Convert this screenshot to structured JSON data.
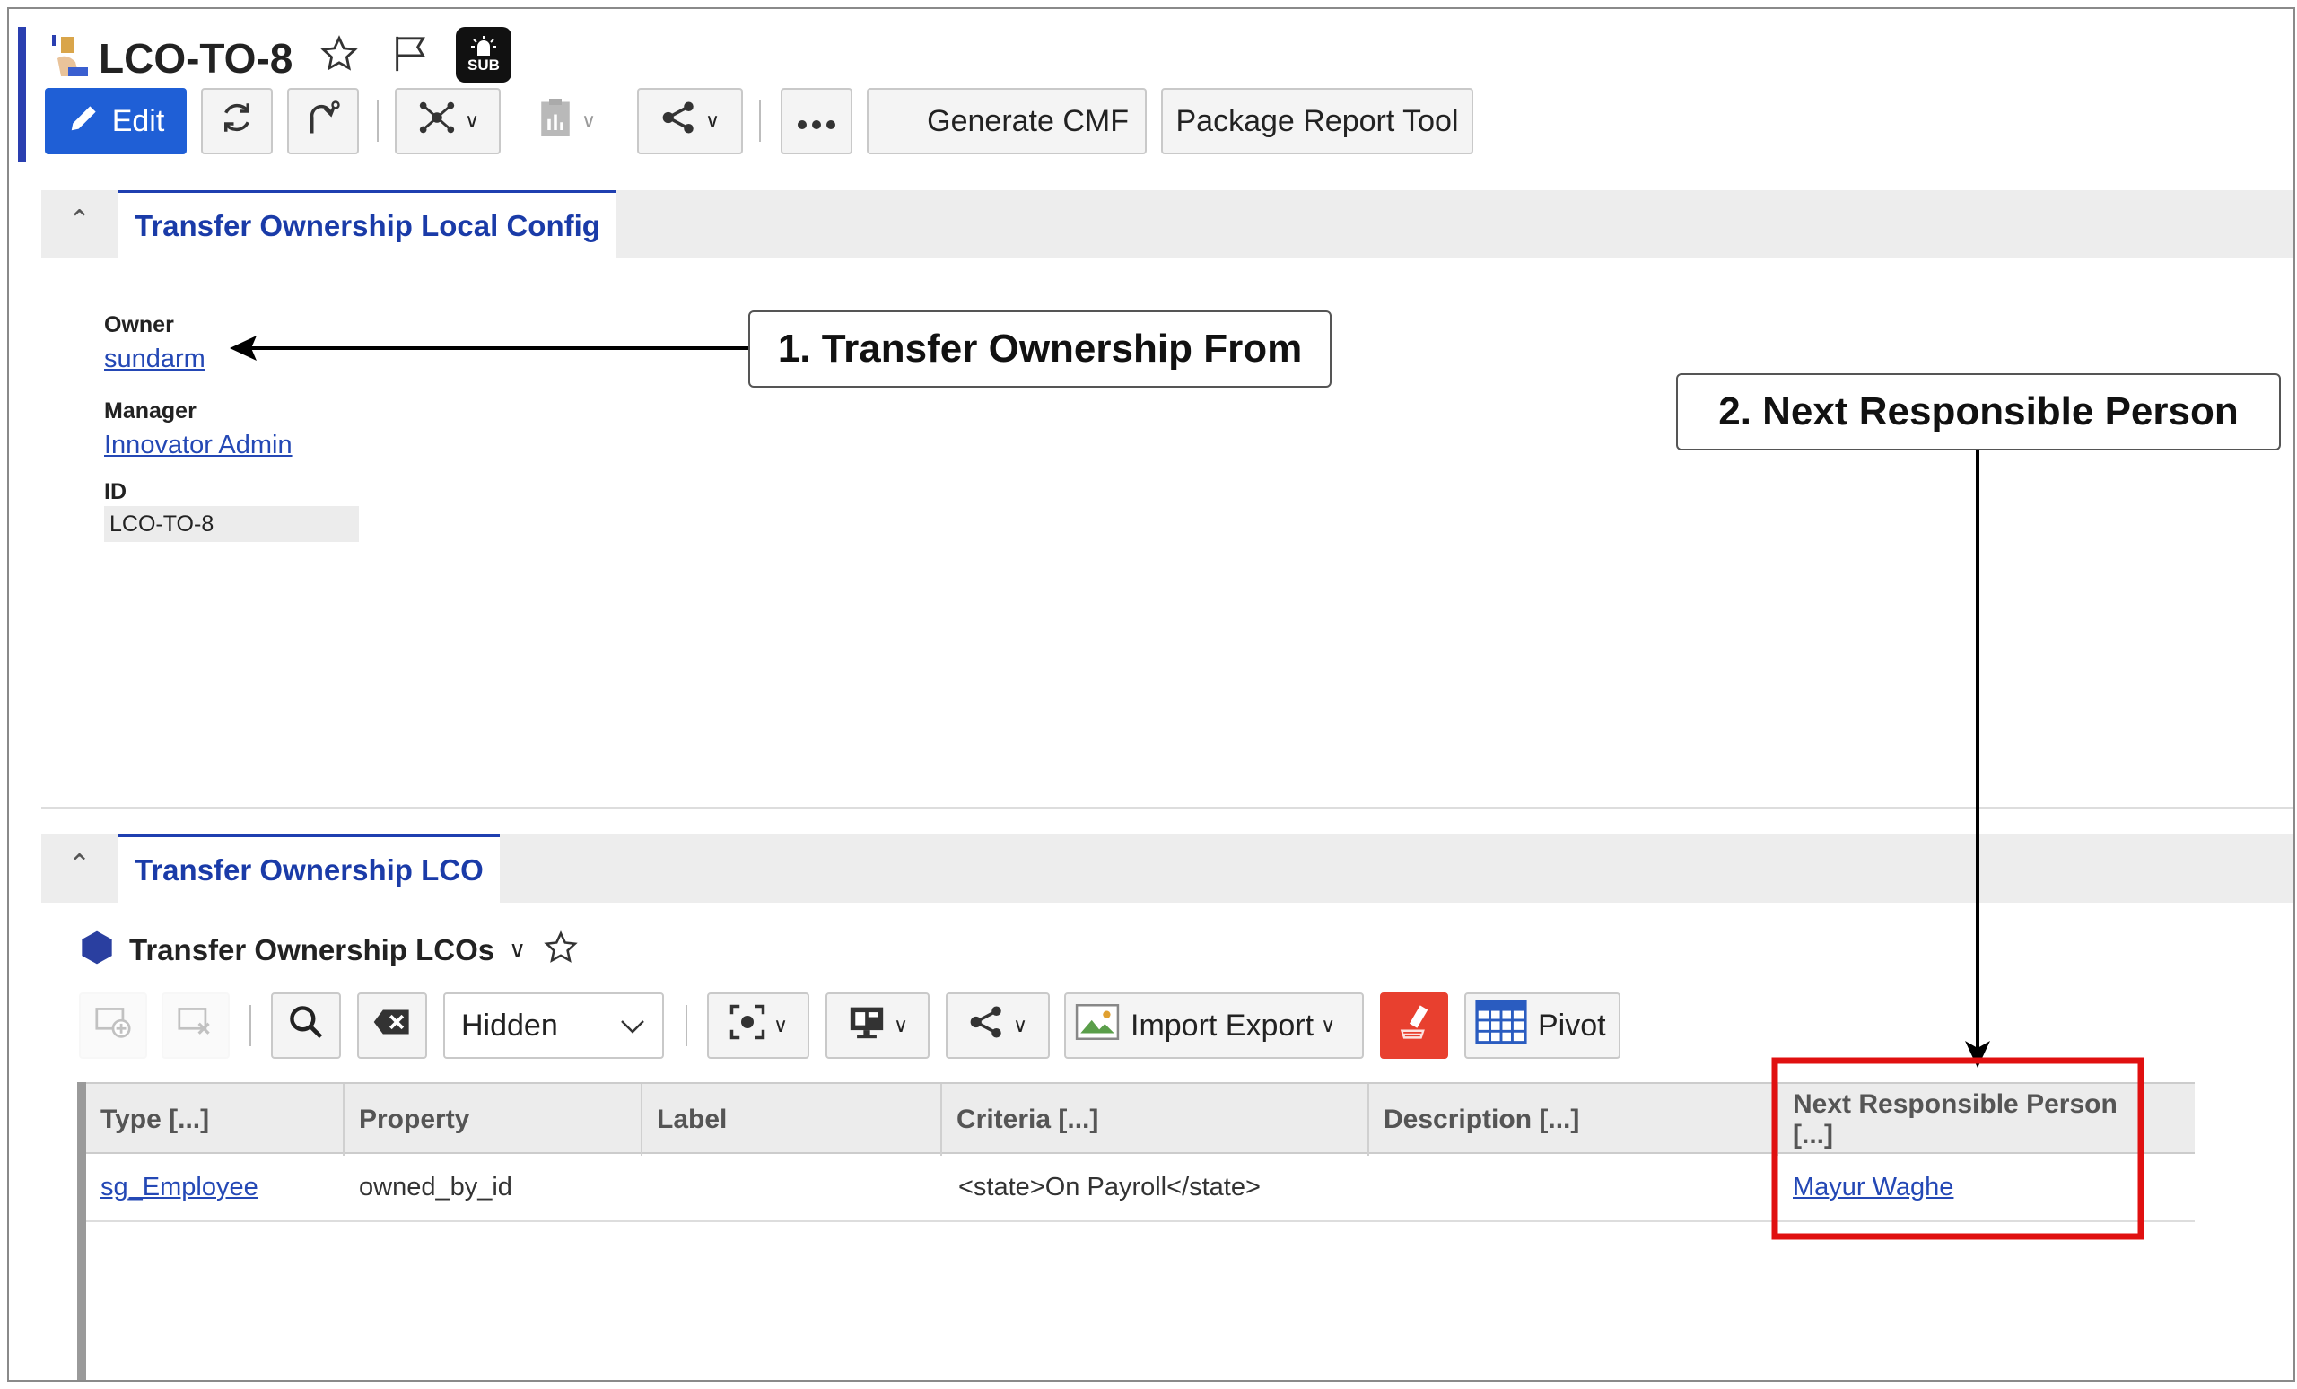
{
  "header": {
    "title": "LCO-TO-8",
    "sub_badge": "SUB"
  },
  "toolbar": {
    "edit_label": "Edit",
    "generate_cmf_label": "Generate CMF",
    "package_report_label": "Package Report Tool"
  },
  "section1": {
    "tab_label": "Transfer Ownership Local Config",
    "owner_label": "Owner",
    "owner_value": "sundarm",
    "manager_label": "Manager",
    "manager_value": "Innovator Admin",
    "id_label": "ID",
    "id_value": "LCO-TO-8"
  },
  "section2": {
    "tab_label": "Transfer Ownership LCO",
    "grid_title": "Transfer Ownership LCOs",
    "filter_select": "Hidden",
    "import_export_label": "Import Export",
    "pivot_label": "Pivot",
    "columns": [
      "Type [...]",
      "Property",
      "Label",
      "Criteria [...]",
      "Description [...]",
      "Next Responsible Person [...]"
    ],
    "rows": [
      {
        "type": "sg_Employee",
        "property": "owned_by_id",
        "label": "",
        "criteria": "<state>On Payroll</state>",
        "description": "",
        "next_responsible_person": "Mayur Waghe"
      }
    ]
  },
  "annotations": {
    "callout1": "1. Transfer Ownership From",
    "callout2": "2. Next Responsible Person",
    "highlight_color": "#e01010"
  },
  "colors": {
    "accent_blue": "#1f5fd6",
    "link_blue": "#2448b5",
    "tab_blue": "#1a3ba8"
  },
  "icons": [
    "item-type-icon",
    "star-icon",
    "flag-icon",
    "subscribe-alarm-icon",
    "edit-pencil-icon",
    "refresh-icon",
    "promote-icon",
    "structure-icon",
    "clipboard-report-icon",
    "share-icon",
    "more-icon",
    "hexagon-icon",
    "add-row-icon",
    "delete-row-icon",
    "search-icon",
    "clear-icon",
    "screen-capture-icon",
    "display-icon",
    "image-icon",
    "eraser-icon",
    "pivot-grid-icon"
  ]
}
